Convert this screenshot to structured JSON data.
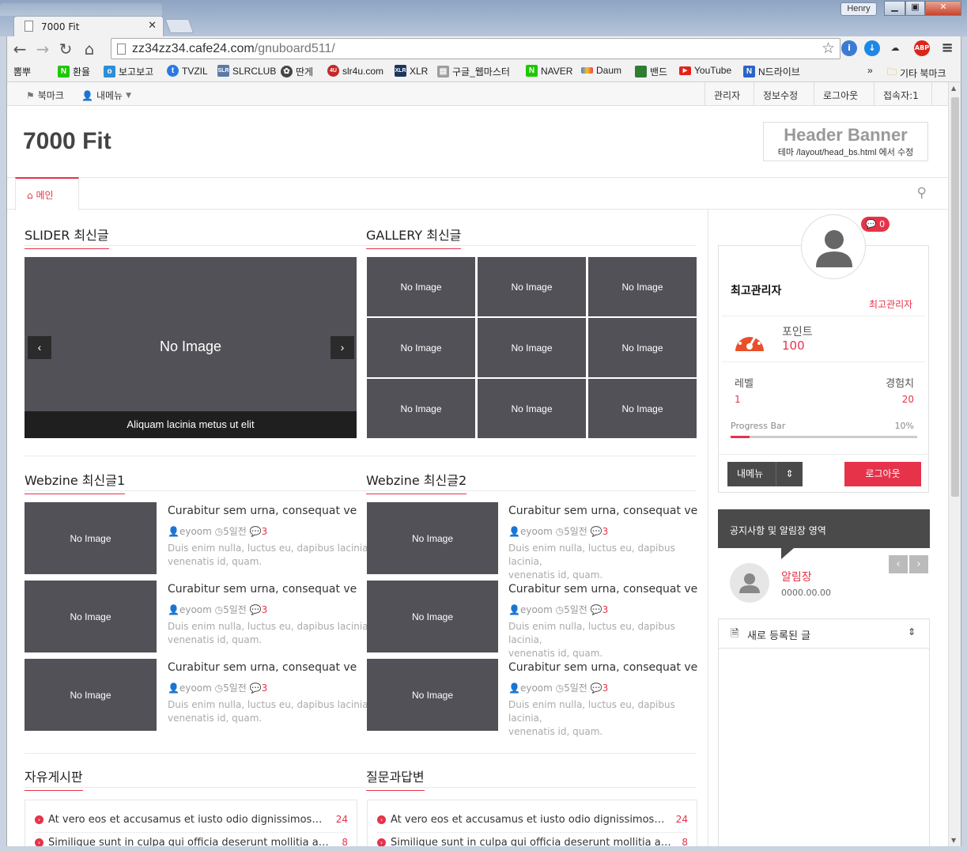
{
  "browser": {
    "tab_title": "7000 Fit",
    "url_host": "zz34zz34.cafe24.com",
    "url_path": "/gnuboard511/",
    "user": "Henry",
    "bookmarks": [
      "뽐뿌",
      "환율",
      "보고보고",
      "TVZIL",
      "SLRCLUB",
      "딴게",
      "slr4u.com",
      "XLR",
      "구글_웹마스터",
      "NAVER",
      "Daum",
      "밴드",
      "YouTube",
      "N드라이브"
    ],
    "bookmarks_more": "»",
    "other_bookmarks": "기타 북마크"
  },
  "colors": {
    "accent": "#e6334a",
    "noimage": "#535158"
  },
  "topnav": {
    "bookmark": "북마크",
    "mymenu": "내메뉴",
    "admin": "관리자",
    "edit_info": "정보수정",
    "logout": "로그아웃",
    "visitors": "접속자:1"
  },
  "header": {
    "site_title": "7000 Fit",
    "banner_title": "Header Banner",
    "banner_sub": "테마 /layout/head_bs.html 에서 수정"
  },
  "menu": {
    "home": "메인"
  },
  "slider": {
    "title": "SLIDER 최신글",
    "no_image": "No Image",
    "caption": "Aliquam lacinia metus ut elit",
    "prev": "‹",
    "next": "›"
  },
  "gallery": {
    "title": "GALLERY 최신글",
    "cells": [
      "No Image",
      "No Image",
      "No Image",
      "No Image",
      "No Image",
      "No Image",
      "No Image",
      "No Image",
      "No Image"
    ]
  },
  "webzine1": {
    "title": "Webzine 최신글1",
    "items": [
      {
        "thumb": "No Image",
        "title": "Curabitur sem urna, consequat ve",
        "author": "eyoom",
        "time": "5일전",
        "comments": "3",
        "desc1": "Duis enim nulla, luctus eu, dapibus lacinia,",
        "desc2": "venenatis id, quam."
      },
      {
        "thumb": "No Image",
        "title": "Curabitur sem urna, consequat ve",
        "author": "eyoom",
        "time": "5일전",
        "comments": "3",
        "desc1": "Duis enim nulla, luctus eu, dapibus lacinia,",
        "desc2": "venenatis id, quam."
      },
      {
        "thumb": "No Image",
        "title": "Curabitur sem urna, consequat ve",
        "author": "eyoom",
        "time": "5일전",
        "comments": "3",
        "desc1": "Duis enim nulla, luctus eu, dapibus lacinia,",
        "desc2": "venenatis id, quam."
      }
    ]
  },
  "webzine2": {
    "title": "Webzine 최신글2",
    "items": [
      {
        "thumb": "No Image",
        "title": "Curabitur sem urna, consequat ve",
        "author": "eyoom",
        "time": "5일전",
        "comments": "3",
        "desc1": "Duis enim nulla, luctus eu, dapibus lacinia,",
        "desc2": "venenatis id, quam."
      },
      {
        "thumb": "No Image",
        "title": "Curabitur sem urna, consequat ve",
        "author": "eyoom",
        "time": "5일전",
        "comments": "3",
        "desc1": "Duis enim nulla, luctus eu, dapibus lacinia,",
        "desc2": "venenatis id, quam."
      },
      {
        "thumb": "No Image",
        "title": "Curabitur sem urna, consequat ve",
        "author": "eyoom",
        "time": "5일전",
        "comments": "3",
        "desc1": "Duis enim nulla, luctus eu, dapibus lacinia,",
        "desc2": "venenatis id, quam."
      }
    ]
  },
  "freeboard": {
    "title": "자유게시판",
    "rows": [
      {
        "text": "At vero eos et accusamus et iusto odio dignissimos…",
        "count": "24"
      },
      {
        "text": "Similique sunt in culpa qui officia deserunt mollitia a…",
        "count": "8"
      }
    ]
  },
  "qna": {
    "title": "질문과답변",
    "rows": [
      {
        "text": "At vero eos et accusamus et iusto odio dignissimos…",
        "count": "24"
      },
      {
        "text": "Similique sunt in culpa qui officia deserunt mollitia a…",
        "count": "8"
      }
    ]
  },
  "profile": {
    "messages": "0",
    "name": "최고관리자",
    "level_name": "최고관리자",
    "point_label": "포인트",
    "point_value": "100",
    "level_label": "레벨",
    "level_value": "1",
    "exp_label": "경험치",
    "exp_value": "20",
    "progress_label": "Progress Bar",
    "progress_text": "10%",
    "progress_fraction": 0.1,
    "mymenu_button": "내메뉴",
    "logout_button": "로그아웃"
  },
  "notice": {
    "title": "공지사항 및 알림장 영역",
    "name": "알림장",
    "date": "0000.00.00"
  },
  "newposts": {
    "title": "새로 등록된 글"
  }
}
